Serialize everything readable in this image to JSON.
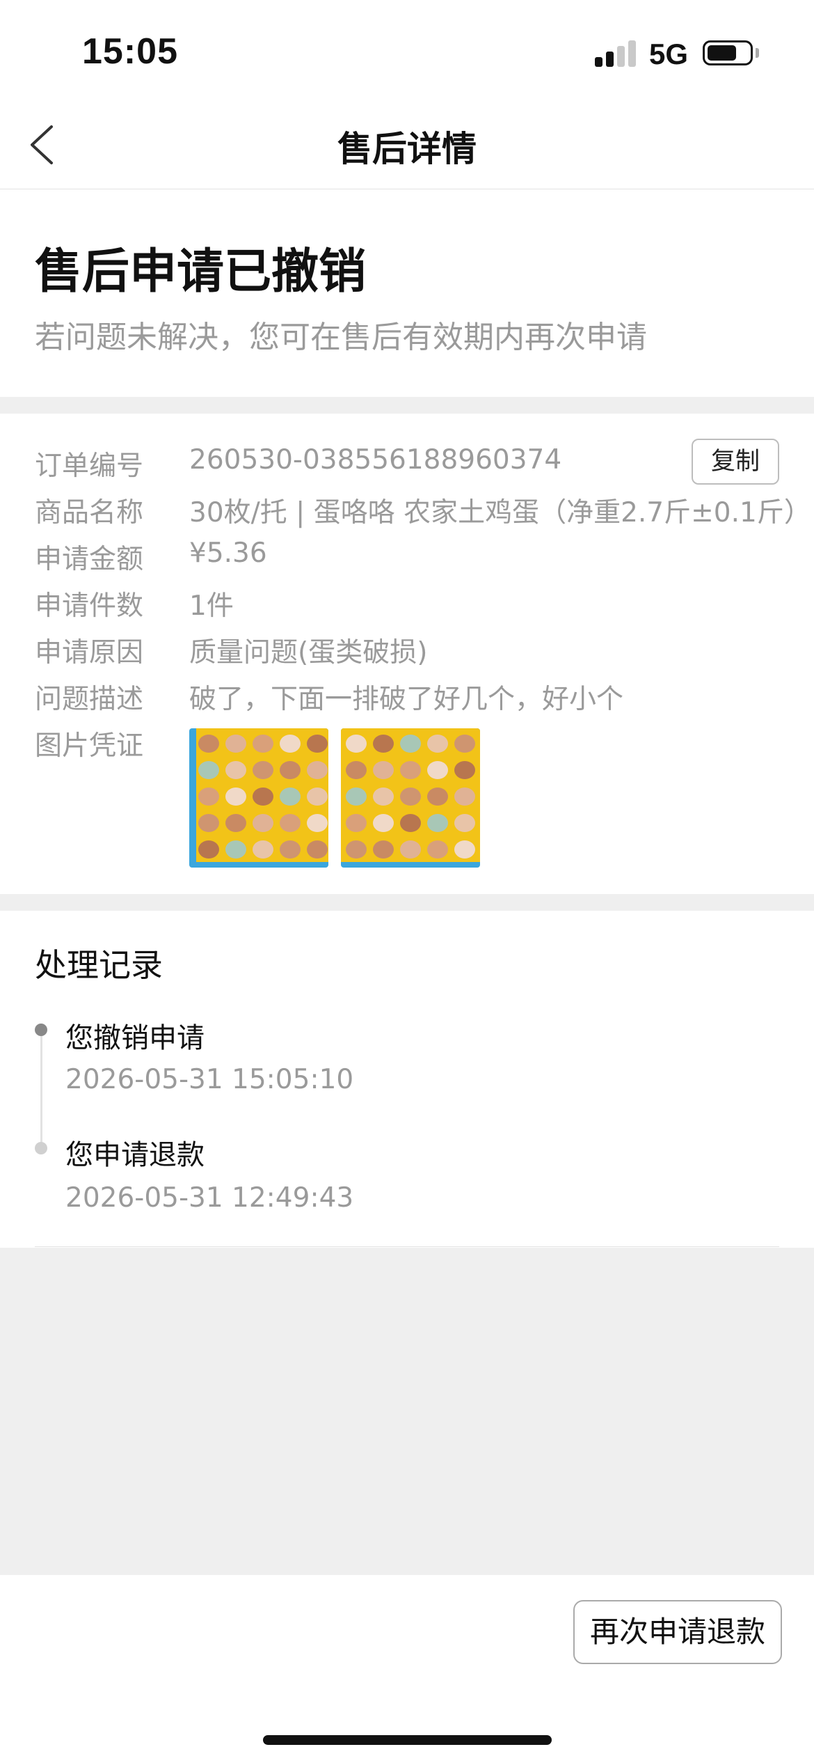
{
  "status_bar": {
    "time": "15:05",
    "network": "5G",
    "battery_level": 0.7
  },
  "nav": {
    "title": "售后详情",
    "back_icon": "chevron-left-icon"
  },
  "status": {
    "heading": "售后申请已撤销",
    "subtitle": "若问题未解决，您可在售后有效期内再次申请"
  },
  "details": {
    "copy_label": "复制",
    "rows": [
      {
        "label": "订单编号",
        "value": "260530-038556188960374"
      },
      {
        "label": "商品名称",
        "value": "30枚/托 | 蛋咯咯 农家土鸡蛋（净重2.7斤±0.1斤）"
      },
      {
        "label": "申请金额",
        "value": "¥5.36"
      },
      {
        "label": "申请件数",
        "value": "1件"
      },
      {
        "label": "申请原因",
        "value": "质量问题(蛋类破损)"
      },
      {
        "label": "问题描述",
        "value": "破了，下面一排破了好几个，好小个"
      },
      {
        "label": "图片凭证",
        "value": ""
      }
    ],
    "evidence_images": [
      "egg-tray-photo-1",
      "egg-tray-photo-2"
    ]
  },
  "log": {
    "title": "处理记录",
    "events": [
      {
        "text": "您撤销申请",
        "time": "2026-05-31 15:05:10"
      },
      {
        "text": "您申请退款",
        "time": "2026-05-31 12:49:43"
      }
    ]
  },
  "actions": {
    "reapply_label": "再次申请退款"
  },
  "colors": {
    "page_bg": "#efefef",
    "muted_text": "#9a9a9a",
    "egg_tray": "#f2c318",
    "tray_base": "#3ba6dd"
  }
}
